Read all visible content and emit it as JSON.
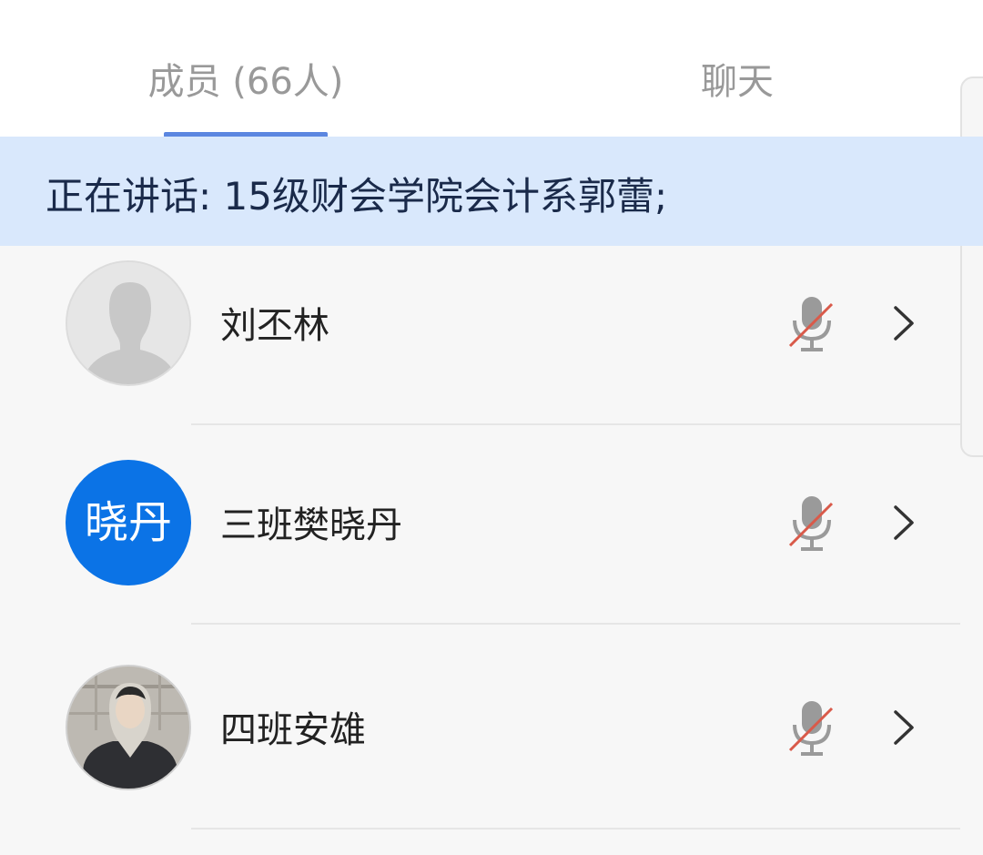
{
  "tabs": [
    {
      "label": "成员 (66人)",
      "active": true
    },
    {
      "label": "聊天",
      "active": false
    }
  ],
  "speaking": {
    "text": "正在讲话: 15级财会学院会计系郭蕾;"
  },
  "members": [
    {
      "name": "刘丕林",
      "avatar_type": "default",
      "mic": "muted"
    },
    {
      "name": "三班樊晓丹",
      "avatar_type": "text",
      "avatar_text": "晓丹",
      "mic": "muted"
    },
    {
      "name": "四班安雄",
      "avatar_type": "photo",
      "mic": "muted"
    }
  ],
  "colors": {
    "tab_indicator": "#5b86e0",
    "banner_bg": "#d9e8fc",
    "text_avatar_bg": "#0b73e6",
    "mute_slash": "#d95a4a"
  },
  "icons": {
    "mic": "microphone-muted-icon",
    "chevron": "chevron-right-icon",
    "default_avatar": "person-silhouette-icon"
  }
}
